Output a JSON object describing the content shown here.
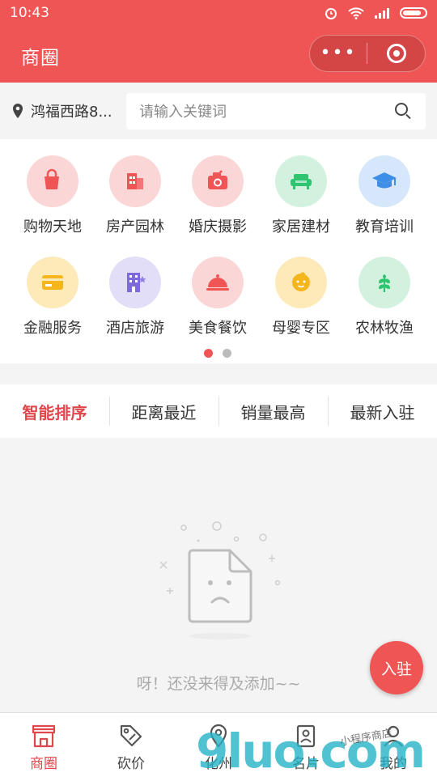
{
  "status": {
    "time": "10:43"
  },
  "header": {
    "title": "商圈",
    "more": "•••"
  },
  "search": {
    "location": "鸿福西路8...",
    "placeholder": "请输入关键词"
  },
  "categories": [
    {
      "label": "购物天地",
      "icon": "shopping-bag-icon",
      "bg": "#fbd6d6",
      "color": "#f05555"
    },
    {
      "label": "房产园林",
      "icon": "building-icon",
      "bg": "#fbd6d6",
      "color": "#f05555"
    },
    {
      "label": "婚庆摄影",
      "icon": "camera-icon",
      "bg": "#fbd6d6",
      "color": "#f05555"
    },
    {
      "label": "家居建材",
      "icon": "sofa-icon",
      "bg": "#d3f1df",
      "color": "#2fc470"
    },
    {
      "label": "教育培训",
      "icon": "graduation-cap-icon",
      "bg": "#d6e6fb",
      "color": "#3d8ee8"
    },
    {
      "label": "金融服务",
      "icon": "card-icon",
      "bg": "#fdeab8",
      "color": "#f4b51d"
    },
    {
      "label": "酒店旅游",
      "icon": "hotel-icon",
      "bg": "#e2def8",
      "color": "#7e6ad8"
    },
    {
      "label": "美食餐饮",
      "icon": "food-cloche-icon",
      "bg": "#fbd6d6",
      "color": "#f05555"
    },
    {
      "label": "母婴专区",
      "icon": "baby-icon",
      "bg": "#fdeab8",
      "color": "#f4b51d"
    },
    {
      "label": "农林牧渔",
      "icon": "leaf-icon",
      "bg": "#d3f1df",
      "color": "#2fc470"
    }
  ],
  "sort": [
    "智能排序",
    "距离最近",
    "销量最高",
    "最新入驻"
  ],
  "empty": {
    "text": "呀！还没来得及添加~~"
  },
  "fab": {
    "label": "入驻"
  },
  "tabs": [
    {
      "label": "商圈",
      "icon": "shop-icon"
    },
    {
      "label": "砍价",
      "icon": "tag-icon"
    },
    {
      "label": "化州",
      "icon": "location-icon"
    },
    {
      "label": "名片",
      "icon": "card-holder-icon"
    },
    {
      "label": "我的",
      "icon": "user-icon"
    }
  ],
  "watermark": {
    "text": "9luo.com",
    "handwriting": "小程序商店"
  },
  "colors": {
    "primary": "#f05555",
    "active": "#e0474c"
  }
}
